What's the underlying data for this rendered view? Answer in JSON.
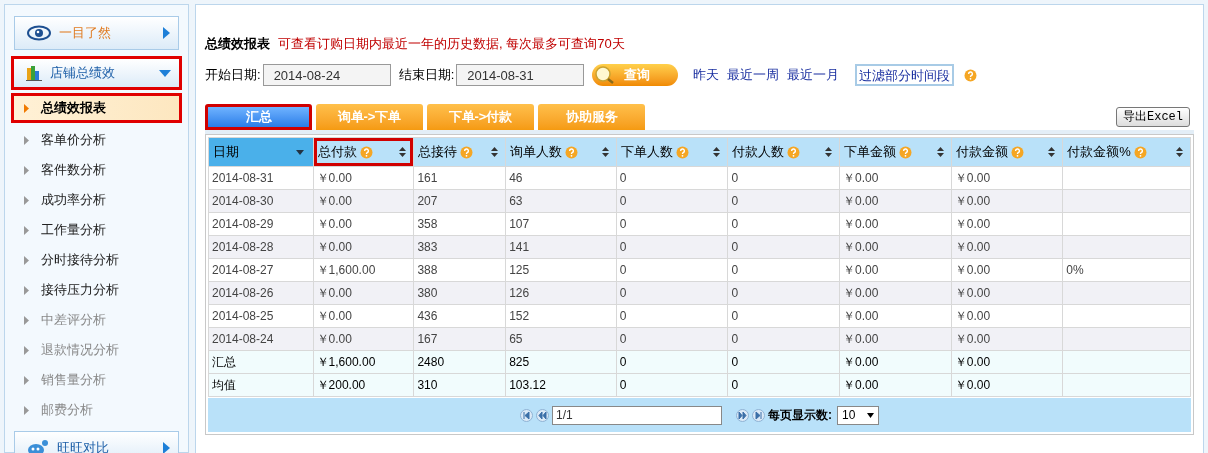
{
  "sidebar": {
    "sections": [
      {
        "label": "一目了然",
        "kind": "eye",
        "expanded": false,
        "highlighted": false
      },
      {
        "label": "店铺总绩效",
        "kind": "chart",
        "expanded": true,
        "highlighted": true,
        "items": [
          {
            "label": "总绩效报表",
            "selected": true,
            "disabled": false,
            "highlighted": true
          },
          {
            "label": "客单价分析",
            "selected": false,
            "disabled": false,
            "highlighted": false
          },
          {
            "label": "客件数分析",
            "selected": false,
            "disabled": false,
            "highlighted": false
          },
          {
            "label": "成功率分析",
            "selected": false,
            "disabled": false,
            "highlighted": false
          },
          {
            "label": "工作量分析",
            "selected": false,
            "disabled": false,
            "highlighted": false
          },
          {
            "label": "分时接待分析",
            "selected": false,
            "disabled": false,
            "highlighted": false
          },
          {
            "label": "接待压力分析",
            "selected": false,
            "disabled": false,
            "highlighted": false
          },
          {
            "label": "中差评分析",
            "selected": false,
            "disabled": true,
            "highlighted": false
          },
          {
            "label": "退款情况分析",
            "selected": false,
            "disabled": true,
            "highlighted": false
          },
          {
            "label": "销售量分析",
            "selected": false,
            "disabled": true,
            "highlighted": false
          },
          {
            "label": "邮费分析",
            "selected": false,
            "disabled": true,
            "highlighted": false
          }
        ]
      },
      {
        "label": "旺旺对比",
        "kind": "wangwang",
        "expanded": false,
        "highlighted": false
      }
    ]
  },
  "header": {
    "title": "总绩效报表",
    "notice": "可查看订购日期内最近一年的历史数据, 每次最多可查询70天"
  },
  "filters": {
    "start_label": "开始日期:",
    "start_value": "2014-08-24",
    "end_label": "结束日期:",
    "end_value": "2014-08-31",
    "query_button": "查询",
    "quick_links": [
      "昨天",
      "最近一周",
      "最近一月"
    ],
    "filter_button": "过滤部分时间段"
  },
  "tabs": [
    {
      "label": "汇总",
      "selected": true,
      "highlighted": true
    },
    {
      "label": "询单->下单",
      "selected": false,
      "highlighted": false
    },
    {
      "label": "下单->付款",
      "selected": false,
      "highlighted": false
    },
    {
      "label": "协助服务",
      "selected": false,
      "highlighted": false
    }
  ],
  "export_button": "导出Excel",
  "table": {
    "columns": [
      {
        "label": "日期",
        "help": false,
        "sorted": true,
        "highlighted": false
      },
      {
        "label": "总付款",
        "help": true,
        "sorted": false,
        "highlighted": true
      },
      {
        "label": "总接待",
        "help": true,
        "sorted": false,
        "highlighted": false
      },
      {
        "label": "询单人数",
        "help": true,
        "sorted": false,
        "highlighted": false
      },
      {
        "label": "下单人数",
        "help": true,
        "sorted": false,
        "highlighted": false
      },
      {
        "label": "付款人数",
        "help": true,
        "sorted": false,
        "highlighted": false
      },
      {
        "label": "下单金额",
        "help": true,
        "sorted": false,
        "highlighted": false
      },
      {
        "label": "付款金额",
        "help": true,
        "sorted": false,
        "highlighted": false
      },
      {
        "label": "付款金额%",
        "help": true,
        "sorted": false,
        "highlighted": false
      }
    ],
    "rows": [
      {
        "kind": "data",
        "cells": [
          "2014-08-31",
          "￥0.00",
          "161",
          "46",
          "0",
          "0",
          "￥0.00",
          "￥0.00",
          ""
        ]
      },
      {
        "kind": "data",
        "cells": [
          "2014-08-30",
          "￥0.00",
          "207",
          "63",
          "0",
          "0",
          "￥0.00",
          "￥0.00",
          ""
        ]
      },
      {
        "kind": "data",
        "cells": [
          "2014-08-29",
          "￥0.00",
          "358",
          "107",
          "0",
          "0",
          "￥0.00",
          "￥0.00",
          ""
        ]
      },
      {
        "kind": "data",
        "cells": [
          "2014-08-28",
          "￥0.00",
          "383",
          "141",
          "0",
          "0",
          "￥0.00",
          "￥0.00",
          ""
        ]
      },
      {
        "kind": "data",
        "cells": [
          "2014-08-27",
          "￥1,600.00",
          "388",
          "125",
          "0",
          "0",
          "￥0.00",
          "￥0.00",
          "0%"
        ]
      },
      {
        "kind": "data",
        "cells": [
          "2014-08-26",
          "￥0.00",
          "380",
          "126",
          "0",
          "0",
          "￥0.00",
          "￥0.00",
          ""
        ]
      },
      {
        "kind": "data",
        "cells": [
          "2014-08-25",
          "￥0.00",
          "436",
          "152",
          "0",
          "0",
          "￥0.00",
          "￥0.00",
          ""
        ]
      },
      {
        "kind": "data",
        "cells": [
          "2014-08-24",
          "￥0.00",
          "167",
          "65",
          "0",
          "0",
          "￥0.00",
          "￥0.00",
          ""
        ]
      },
      {
        "kind": "summary",
        "cells": [
          "汇总",
          "￥1,600.00",
          "2480",
          "825",
          "0",
          "0",
          "￥0.00",
          "￥0.00",
          ""
        ]
      },
      {
        "kind": "summary",
        "cells": [
          "均值",
          "￥200.00",
          "310",
          "103.12",
          "0",
          "0",
          "￥0.00",
          "￥0.00",
          ""
        ]
      }
    ]
  },
  "pagination": {
    "page_value": "1/1",
    "page_size_label": "每页显示数:",
    "page_size": "10"
  }
}
